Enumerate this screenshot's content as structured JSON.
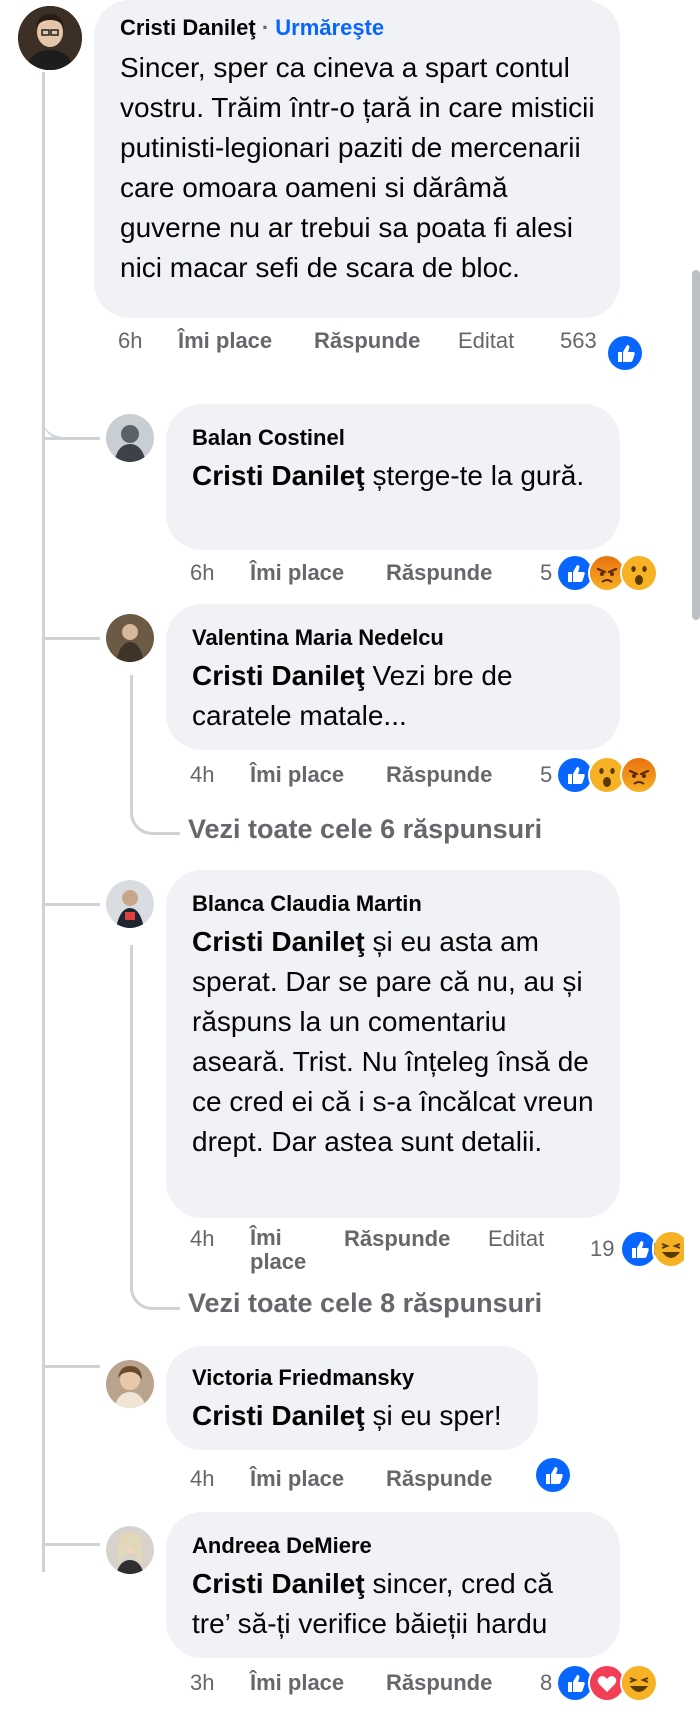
{
  "comments": [
    {
      "author": "Cristi Danileţ",
      "follow_label": "Urmăreşte",
      "follow_sep": "·",
      "text": "Sincer, sper ca cineva a spart contul vostru. Trăim într-o țară in care misticii putinisti-legionari paziti de mercenarii care omoara oameni si dărâmă guverne nu ar trebui sa poata fi alesi nici macar sefi de scara de bloc.",
      "time": "6h",
      "like_label": "Îmi place",
      "reply_label": "Răspunde",
      "edited_label": "Editat",
      "reaction_count": "563",
      "reactions": [
        "like-icon"
      ]
    }
  ],
  "replies": [
    {
      "author": "Balan Costinel",
      "mention": "Cristi Danileţ",
      "text": " șterge-te la gură.",
      "time": "6h",
      "like_label": "Îmi place",
      "reply_label": "Răspunde",
      "reaction_count": "5",
      "reactions": [
        "like-icon",
        "angry-icon",
        "wow-icon"
      ]
    },
    {
      "author": "Valentina Maria Nedelcu",
      "mention": "Cristi Danileţ",
      "text": " Vezi bre de caratele matale...",
      "time": "4h",
      "like_label": "Îmi place",
      "reply_label": "Răspunde",
      "reaction_count": "5",
      "reactions": [
        "like-icon",
        "wow-icon",
        "angry-icon"
      ],
      "view_more": "Vezi toate cele 6 răspunsuri"
    },
    {
      "author": "Blanca Claudia Martin",
      "mention": "Cristi Danileţ",
      "text": " și eu asta am sperat. Dar se pare că nu, au și răspuns la un comentariu aseară. Trist. Nu înțeleg însă de ce cred ei că i s-a încălcat vreun drept. Dar astea sunt detalii.",
      "time": "4h",
      "like_label_line1": "Îmi",
      "like_label_line2": "place",
      "reply_label": "Răspunde",
      "edited_label": "Editat",
      "reaction_count": "19",
      "reactions": [
        "like-icon",
        "haha-icon"
      ],
      "view_more": "Vezi toate cele 8 răspunsuri"
    },
    {
      "author": "Victoria Friedmansky",
      "mention": "Cristi Danileţ",
      "text": " și eu sper!",
      "time": "4h",
      "like_label": "Îmi place",
      "reply_label": "Răspunde",
      "reactions": [
        "like-icon"
      ]
    },
    {
      "author": "Andreea DeMiere",
      "mention": "Cristi Danileţ",
      "text": " sincer, cred că tre’ să-ți verifice băieții hardu",
      "time": "3h",
      "like_label": "Îmi place",
      "reply_label": "Răspunde",
      "reaction_count": "8",
      "reactions": [
        "like-icon",
        "love-icon",
        "haha-icon"
      ]
    }
  ],
  "colors": {
    "bubble": "#f0f2f5",
    "link": "#0866ff",
    "meta": "#65676b",
    "like": "#0866ff",
    "love": "#f33e58",
    "emoji": "#f7b125",
    "angry": "#e9710f"
  }
}
